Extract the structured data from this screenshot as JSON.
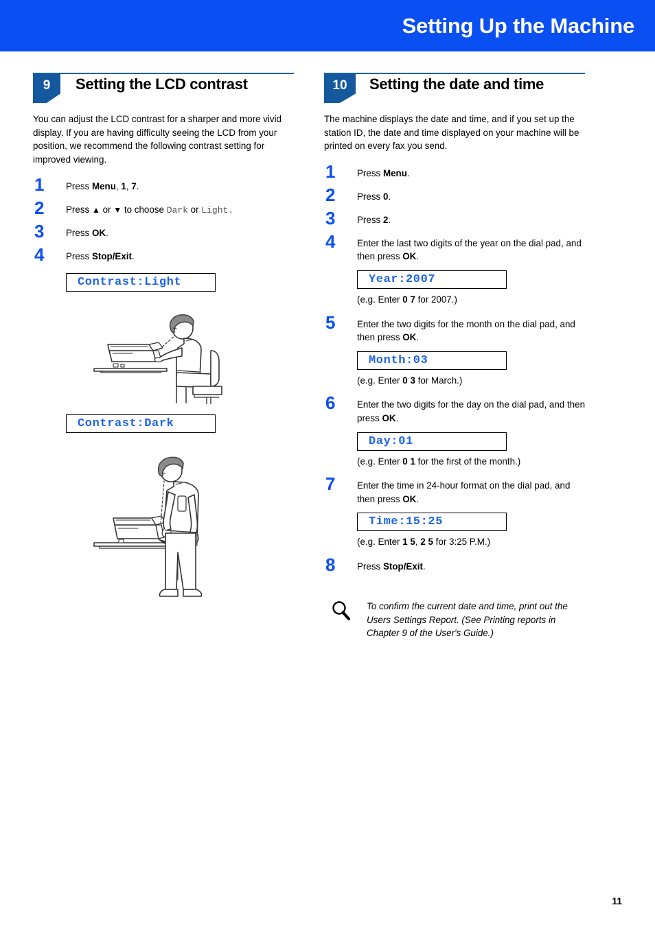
{
  "header": {
    "title": "Setting Up the Machine",
    "banner_color": "#0A4FF2"
  },
  "left_section": {
    "number": "9",
    "title": "Setting the LCD contrast",
    "intro": "You can adjust the LCD contrast for a sharper and more vivid display. If you are having difficulty seeing the LCD from your position, we recommend the following contrast setting for improved viewing.",
    "steps": [
      {
        "number": "1",
        "text_pre": "Press ",
        "bold1": "Menu",
        "mid1": ", ",
        "bold2": "1",
        "mid2": ", ",
        "bold3": "7",
        "text_post": "."
      },
      {
        "number": "2",
        "full": "Press ▲ or ▼ to choose Dark or Light."
      },
      {
        "number": "3",
        "text_pre": "Press ",
        "bold1": "OK",
        "text_post": "."
      },
      {
        "number": "4",
        "text_pre": "Press ",
        "bold1": "Stop/Exit",
        "text_post": "."
      }
    ],
    "lcd_light": "Contrast:Light",
    "lcd_dark": "Contrast:Dark",
    "step2_parts": {
      "press": "Press",
      "up_arrow": "▲",
      "or": "or",
      "down_arrow": "▼",
      "to_choose": "to choose",
      "dark": "Dark",
      "or2": "or",
      "light": "Light",
      "period": "."
    },
    "figure_seated_alt": "person-seated-at-desk-viewing-machine",
    "figure_standing_alt": "person-standing-viewing-machine"
  },
  "right_section": {
    "number": "10",
    "title": "Setting the date and time",
    "intro": "The machine displays the date and time, and if you set up the station ID, the date and time displayed on your machine will be printed on every fax you send.",
    "steps": [
      {
        "number": "1",
        "pre": "Press ",
        "bold": "Menu",
        "post": "."
      },
      {
        "number": "2",
        "pre": "Press ",
        "bold": "0",
        "post": "."
      },
      {
        "number": "3",
        "pre": "Press ",
        "bold": "2",
        "post": "."
      },
      {
        "number": "4",
        "pre": "Enter the last two digits of the year on the dial pad, and then press ",
        "bold": "OK",
        "post": "."
      },
      {
        "number": "5",
        "pre": "Enter the two digits for the month on the dial pad, and then press ",
        "bold": "OK",
        "post": "."
      },
      {
        "number": "6",
        "pre": "Enter the two digits for the day on the dial pad, and then press ",
        "bold": "OK",
        "post": "."
      },
      {
        "number": "7",
        "pre": "Enter the time in 24-hour format on the dial pad, and then press ",
        "bold": "OK",
        "post": "."
      },
      {
        "number": "8",
        "pre": "Press ",
        "bold": "Stop/Exit",
        "post": "."
      }
    ],
    "lcd_year": "Year:2007",
    "lcd_month": "Month:03",
    "lcd_day": "Day:01",
    "lcd_time": "Time:15:25",
    "eg_year": {
      "pre": "(e.g. Enter ",
      "b1": "0",
      "mid": " ",
      "b2": "7",
      "post": " for 2007.)"
    },
    "eg_month": {
      "pre": "(e.g. Enter ",
      "b1": "0",
      "mid": " ",
      "b2": "3",
      "post": " for March.)"
    },
    "eg_day": {
      "pre": "(e.g. Enter ",
      "b1": "0",
      "mid": " ",
      "b2": "1",
      "post": " for the first of the month.)"
    },
    "eg_time": {
      "pre": "(e.g. Enter ",
      "b1": "1 5",
      "mid": ", ",
      "b2": "2 5",
      "post": " for 3:25 P.M.)"
    },
    "note": "To confirm the current date and time, print out the Users Settings Report. (See Printing reports in Chapter 9 of the User's Guide.)"
  },
  "footer": {
    "page_number": "11"
  },
  "colors": {
    "banner_blue": "#0A4FF2",
    "badge_blue": "#14599E",
    "step_number_blue": "#0A4FF2",
    "lcd_text_blue": "#1E64E6",
    "rule_blue": "#1461A8"
  }
}
